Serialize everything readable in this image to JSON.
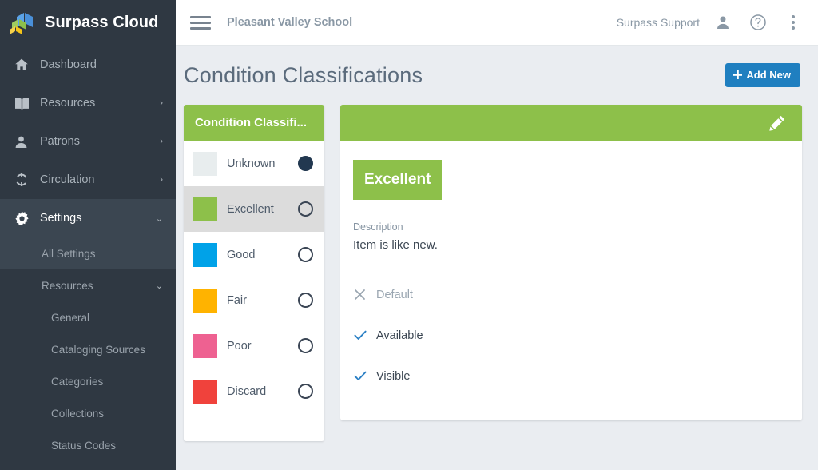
{
  "brand": {
    "name": "Surpass Cloud",
    "logo_icon": "stacked-sheets-logo",
    "logo_colors": [
      "#4a90d9",
      "#8dc04a",
      "#f5c518"
    ]
  },
  "sidebar": {
    "items": [
      {
        "label": "Dashboard",
        "icon": "home-icon",
        "chevron": "",
        "active": false
      },
      {
        "label": "Resources",
        "icon": "book-icon",
        "chevron": "›",
        "active": false
      },
      {
        "label": "Patrons",
        "icon": "person-icon",
        "chevron": "›",
        "active": false
      },
      {
        "label": "Circulation",
        "icon": "refresh-icon",
        "chevron": "›",
        "active": false
      },
      {
        "label": "Settings",
        "icon": "gear-icon",
        "chevron": "⌄",
        "active": true
      }
    ],
    "sub_items": [
      {
        "label": "All Settings",
        "chevron": "",
        "level": 1
      },
      {
        "label": "Resources",
        "chevron": "⌄",
        "level": 1
      },
      {
        "label": "General",
        "chevron": "",
        "level": 2
      },
      {
        "label": "Cataloging Sources",
        "chevron": "",
        "level": 2
      },
      {
        "label": "Categories",
        "chevron": "",
        "level": 2
      },
      {
        "label": "Collections",
        "chevron": "",
        "level": 2
      },
      {
        "label": "Status Codes",
        "chevron": "",
        "level": 2
      }
    ]
  },
  "topbar": {
    "menu_icon": "hamburger-icon",
    "school_name": "Pleasant Valley School",
    "support_user": "Surpass Support",
    "user_icon": "person-icon",
    "help_icon": "help-circle-icon",
    "more_icon": "kebab-menu-icon"
  },
  "page": {
    "title": "Condition Classifications",
    "add_new_label": "Add New",
    "add_new_plus": "➕",
    "accent_blue": "#1f7fc0",
    "accent_green": "#8dc04a",
    "background": "#eaedf1"
  },
  "list_panel": {
    "header": "Condition Classifi...",
    "rows": [
      {
        "label": "Unknown",
        "color": "#e8edee",
        "selected": false,
        "radio_checked": true
      },
      {
        "label": "Excellent",
        "color": "#8dc04a",
        "selected": true,
        "radio_checked": false
      },
      {
        "label": "Good",
        "color": "#00a2e8",
        "selected": false,
        "radio_checked": false
      },
      {
        "label": "Fair",
        "color": "#ffb300",
        "selected": false,
        "radio_checked": false
      },
      {
        "label": "Poor",
        "color": "#ee6191",
        "selected": false,
        "radio_checked": false
      },
      {
        "label": "Discard",
        "color": "#f0423c",
        "selected": false,
        "radio_checked": false
      }
    ]
  },
  "detail": {
    "edit_icon": "pencil-icon",
    "header_color": "#8dc04a",
    "name": "Excellent",
    "name_color": "#8dc04a",
    "description_label": "Description",
    "description_value": "Item is like new.",
    "flags": [
      {
        "label": "Default",
        "state": "off",
        "icon": "x-icon"
      },
      {
        "label": "Available",
        "state": "on",
        "icon": "check-icon"
      },
      {
        "label": "Visible",
        "state": "on",
        "icon": "check-icon"
      }
    ]
  }
}
